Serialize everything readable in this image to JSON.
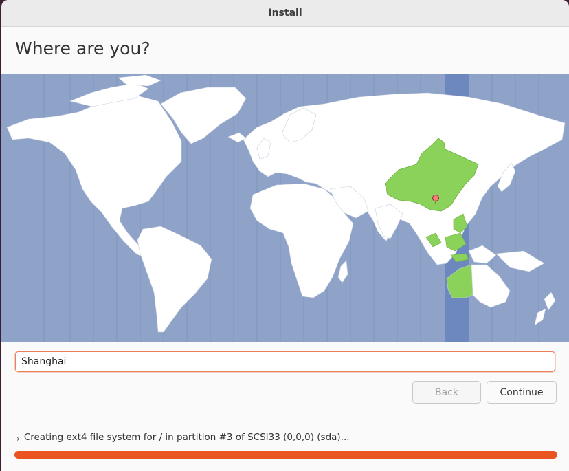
{
  "window": {
    "title": "Install"
  },
  "page": {
    "heading": "Where are you?"
  },
  "map": {
    "selected_city": "Shanghai",
    "highlight_color": "#8bd25a",
    "ocean_color": "#8fa3c9",
    "timezone_band_color": "#6d88bf"
  },
  "timezone_field": {
    "value": "Shanghai"
  },
  "buttons": {
    "back": "Back",
    "continue": "Continue"
  },
  "status": {
    "text": "Creating ext4 file system for / in partition #3 of SCSI33 (0,0,0) (sda)..."
  },
  "progress": {
    "fraction": 1.0,
    "color": "#e95420"
  }
}
